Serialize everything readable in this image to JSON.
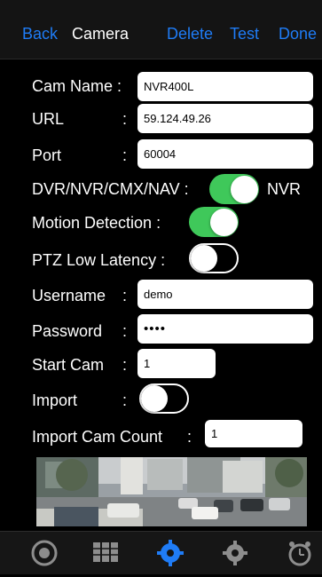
{
  "nav": {
    "back": "Back",
    "title": "Camera",
    "delete": "Delete",
    "test": "Test",
    "done": "Done"
  },
  "form": {
    "cam_name_label": "Cam Name :",
    "cam_name_value": "NVR400L",
    "url_label": "URL",
    "url_colon": ":",
    "url_value": "59.124.49.26",
    "port_label": "Port",
    "port_colon": ":",
    "port_value": "60004",
    "dvr_label": "DVR/NVR/CMX/NAV :",
    "dvr_toggle_on": true,
    "dvr_value": "NVR",
    "motion_label": "Motion Detection :",
    "motion_toggle_on": true,
    "ptz_label": "PTZ Low Latency :",
    "ptz_toggle_on": false,
    "username_label": "Username",
    "username_colon": ":",
    "username_value": "demo",
    "password_label": "Password",
    "password_colon": ":",
    "password_value": "••••",
    "start_cam_label": "Start Cam",
    "start_cam_colon": ":",
    "start_cam_value": "1",
    "import_label": "Import",
    "import_colon": ":",
    "import_toggle_on": false,
    "import_count_label": "Import Cam Count",
    "import_count_colon": ":",
    "import_count_value": "1"
  },
  "tabbar": {
    "tabs": [
      {
        "icon": "camera-lens-icon",
        "active": false
      },
      {
        "icon": "camera-grid-icon",
        "active": false
      },
      {
        "icon": "camera-settings-icon",
        "active": true
      },
      {
        "icon": "gear-icon",
        "active": false
      },
      {
        "icon": "alarm-clock-icon",
        "active": false
      }
    ]
  },
  "colors": {
    "accent": "#1f7cf6",
    "toggle_on": "#3fc85a",
    "background": "#000000"
  }
}
